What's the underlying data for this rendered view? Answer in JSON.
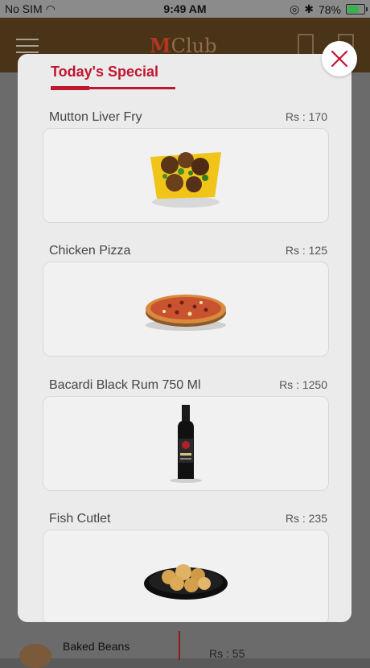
{
  "status_bar": {
    "carrier": "No SIM",
    "time": "9:49 AM",
    "battery": "78%",
    "battery_level": 0.78
  },
  "header": {
    "logo": "Club"
  },
  "background": {
    "item_name": "Baked Beans",
    "item_price": "Rs : 55"
  },
  "modal": {
    "title": "Today's Special",
    "items": [
      {
        "name": "Mutton Liver Fry",
        "price": "Rs : 170",
        "image": "mutton-liver-fry-image"
      },
      {
        "name": "Chicken Pizza",
        "price": "Rs : 125",
        "image": "pizza-image"
      },
      {
        "name": "Bacardi Black Rum 750 Ml",
        "price": "Rs : 1250",
        "image": "rum-bottle-image"
      },
      {
        "name": "Fish Cutlet",
        "price": "Rs : 235",
        "image": "fish-cutlet-image"
      }
    ]
  },
  "colors": {
    "accent": "#c0162e",
    "header": "#4a3418"
  }
}
